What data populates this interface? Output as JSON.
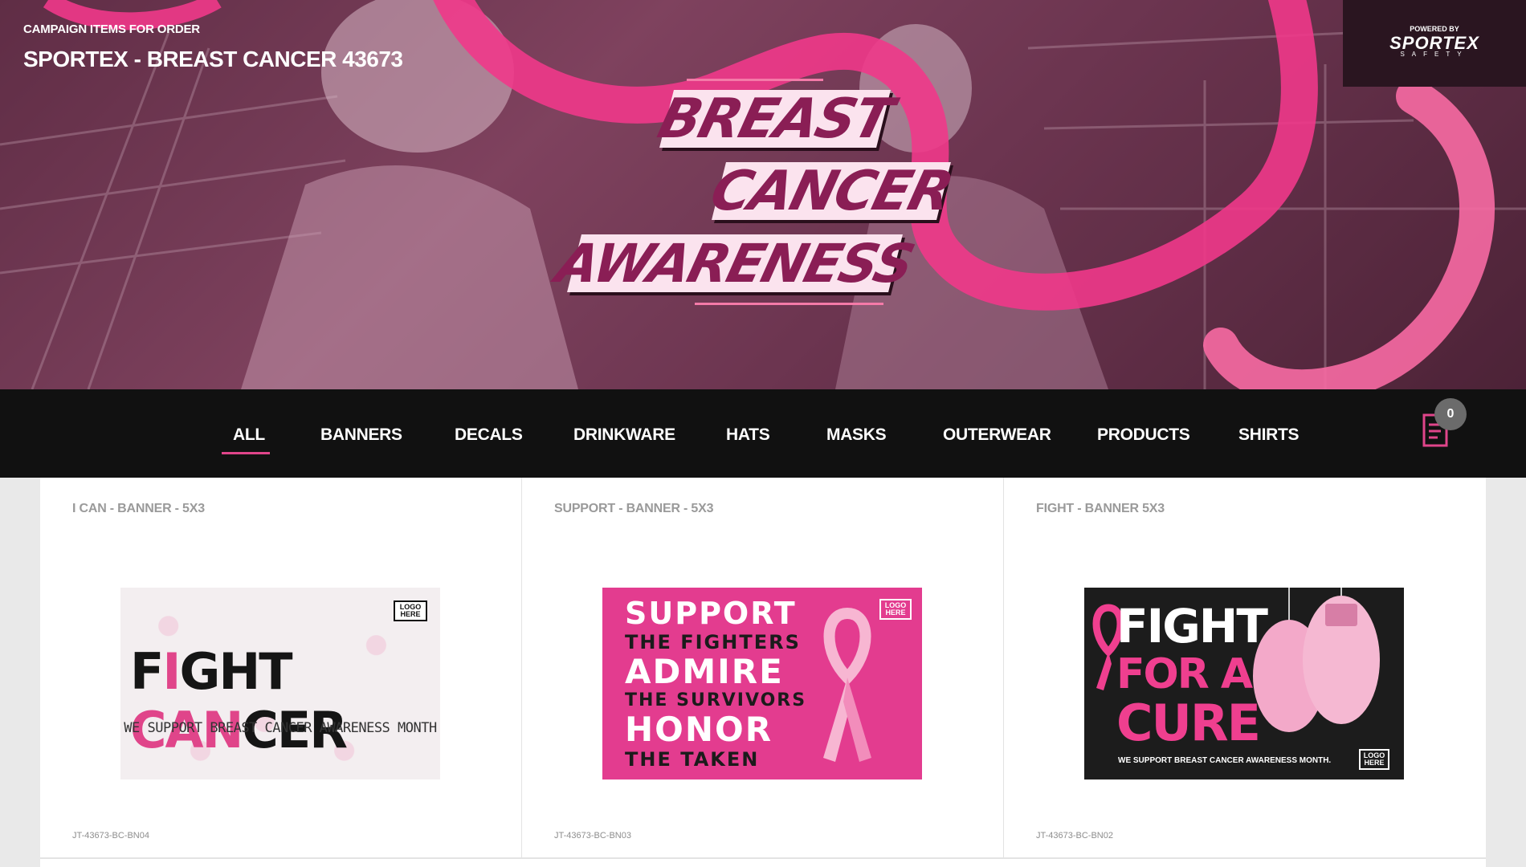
{
  "header": {
    "kicker": "CAMPAIGN ITEMS FOR ORDER",
    "title": "SPORTEX - BREAST CANCER 43673",
    "brand": {
      "powered": "POWERED BY",
      "name": "SPORTEX",
      "sub": "SAFETY"
    },
    "hero_words": [
      "BREAST",
      "CANCER",
      "AWARENESS"
    ]
  },
  "nav": {
    "items": [
      "ALL",
      "BANNERS",
      "DECALS",
      "DRINKWARE",
      "HATS",
      "MASKS",
      "OUTERWEAR",
      "PRODUCTS",
      "SHIRTS"
    ],
    "active": "ALL",
    "cart_count": "0"
  },
  "products": [
    {
      "title": "I CAN - BANNER - 5X3",
      "sku": "JT-43673-BC-BN04",
      "banner": {
        "line1a": "F",
        "line1b": "I",
        "line1c": "GHT ",
        "line1d": "CAN",
        "line1e": "CER",
        "sub": "WE SUPPORT BREAST CANCER AWARENESS MONTH",
        "logo": "LOGO HERE"
      }
    },
    {
      "title": "SUPPORT - BANNER - 5X3",
      "sku": "JT-43673-BC-BN03",
      "banner": {
        "l1": "SUPPORT",
        "l2": "THE FIGHTERS",
        "l3": "ADMIRE",
        "l4": "THE SURVIVORS",
        "l5": "HONOR",
        "l6": "THE TAKEN",
        "logo": "LOGO HERE"
      }
    },
    {
      "title": "FIGHT - BANNER 5X3",
      "sku": "JT-43673-BC-BN02",
      "banner": {
        "l1": "FIGHT",
        "l2": "FOR A",
        "l3": "CURE",
        "sub": "WE SUPPORT BREAST CANCER AWARENESS MONTH.",
        "logo": "LOGO HERE"
      }
    }
  ],
  "colors": {
    "accent": "#e0458a",
    "nav_bg": "#111111",
    "hero_tint": "#8a4a66"
  }
}
